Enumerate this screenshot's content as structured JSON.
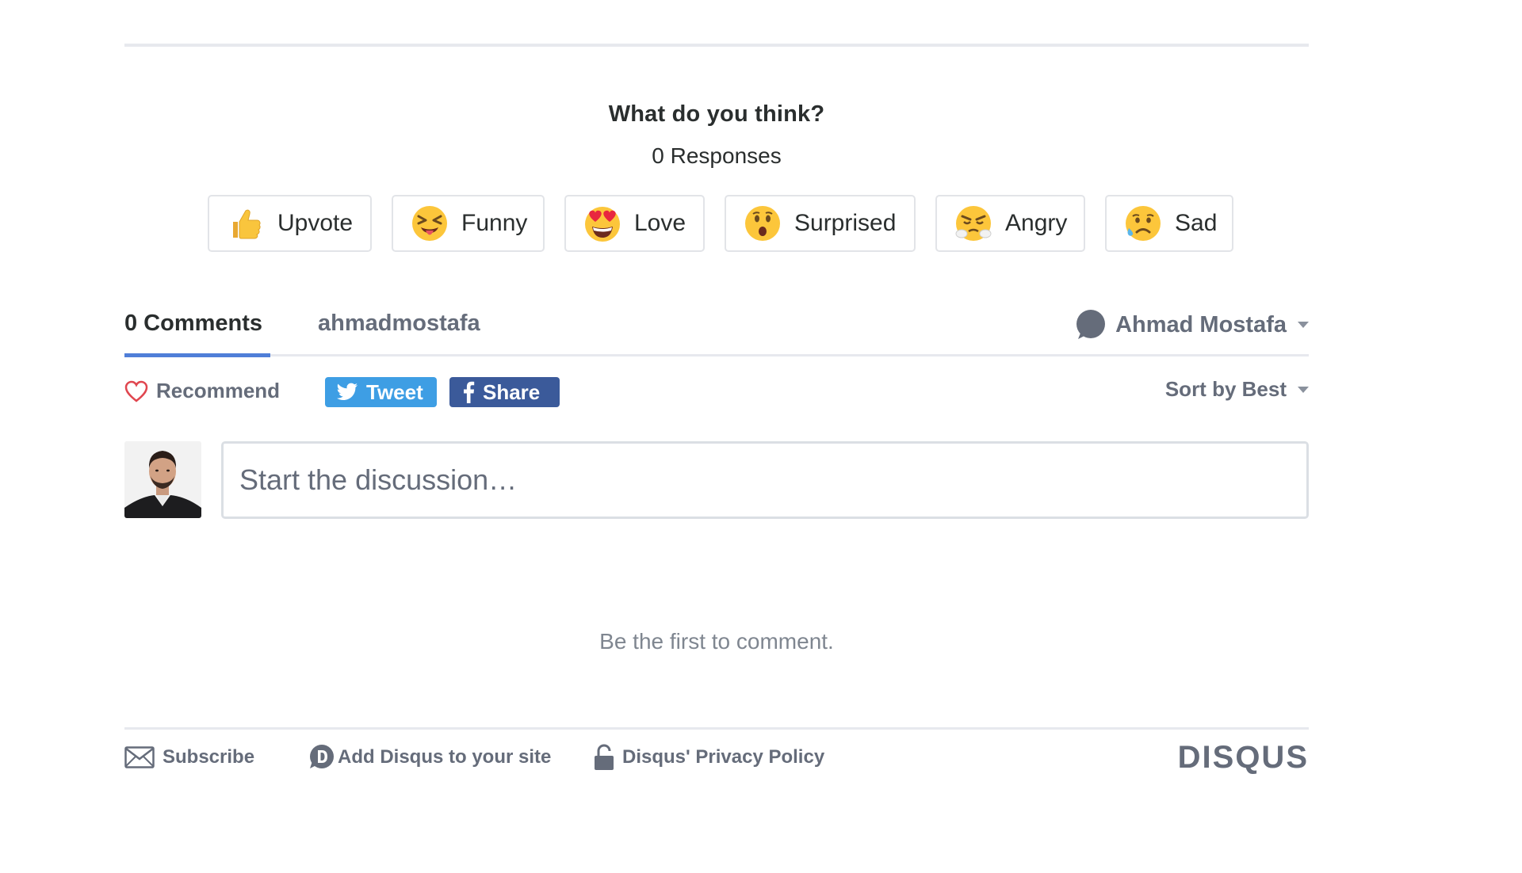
{
  "reactions_header": {
    "title": "What do you think?",
    "responses": "0 Responses"
  },
  "reactions": [
    {
      "label": "Upvote",
      "icon": "thumbs-up-icon"
    },
    {
      "label": "Funny",
      "icon": "squinting-tongue-face-icon"
    },
    {
      "label": "Love",
      "icon": "heart-eyes-face-icon"
    },
    {
      "label": "Surprised",
      "icon": "hushed-face-icon"
    },
    {
      "label": "Angry",
      "icon": "steam-face-icon"
    },
    {
      "label": "Sad",
      "icon": "sad-sweat-face-icon"
    }
  ],
  "tabs": {
    "comments_label": "0 Comments",
    "forum_label": "ahmadmostafa",
    "user_name": "Ahmad Mostafa"
  },
  "actions": {
    "recommend_label": "Recommend",
    "tweet_label": "Tweet",
    "share_label": "Share",
    "sort_label": "Sort by Best"
  },
  "composer": {
    "placeholder": "Start the discussion…"
  },
  "empty_message": "Be the first to comment.",
  "footer": {
    "subscribe_label": "Subscribe",
    "add_disqus_label": "Add Disqus to your site",
    "privacy_label": "Disqus' Privacy Policy",
    "logo_text": "DISQUS"
  },
  "colors": {
    "tab_accent": "#4f7ed8",
    "tweet": "#3e9ee4",
    "facebook": "#3b5a9a",
    "recommend_heart": "#e0464f",
    "muted_text": "#656c7a"
  }
}
